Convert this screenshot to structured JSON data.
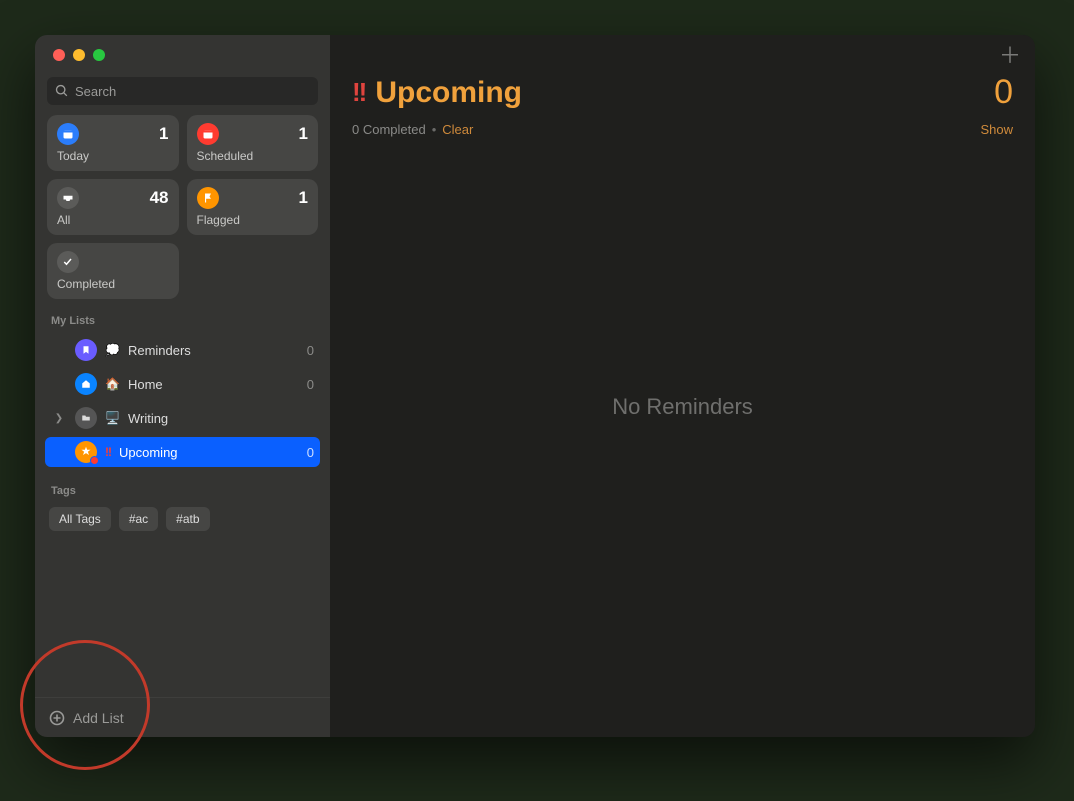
{
  "search": {
    "placeholder": "Search"
  },
  "smart": {
    "today": {
      "label": "Today",
      "count": "1",
      "color": "#2b7dfb"
    },
    "scheduled": {
      "label": "Scheduled",
      "count": "1",
      "color": "#ff3b30"
    },
    "all": {
      "label": "All",
      "count": "48",
      "color": "#5b5b59"
    },
    "flagged": {
      "label": "Flagged",
      "count": "1",
      "color": "#ff9500"
    },
    "completed": {
      "label": "Completed",
      "color": "#5b5b59"
    }
  },
  "lists": {
    "heading": "My Lists",
    "items": [
      {
        "name": "Reminders",
        "emoji": "💭",
        "count": "0",
        "iconColor": "#6a5cff"
      },
      {
        "name": "Home",
        "emoji": "🏠",
        "count": "0",
        "iconColor": "#0a84ff"
      },
      {
        "name": "Writing",
        "emoji": "🖥️",
        "expandable": true
      },
      {
        "name": "Upcoming",
        "prefix": "‼️",
        "count": "0",
        "iconColor": "#ff9500",
        "selected": true,
        "smart": true
      }
    ]
  },
  "tags": {
    "heading": "Tags",
    "items": [
      "All Tags",
      "#ac",
      "#atb"
    ]
  },
  "addList": {
    "label": "Add List"
  },
  "main": {
    "titlePrefix": "!!",
    "title": "Upcoming",
    "count": "0",
    "completedText": "0 Completed",
    "clear": "Clear",
    "show": "Show",
    "empty": "No Reminders",
    "accent": "#f0a13c"
  }
}
